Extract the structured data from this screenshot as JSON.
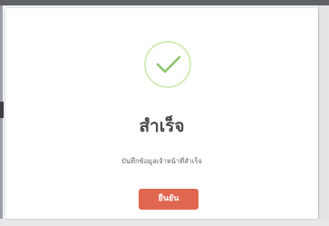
{
  "dialog": {
    "icon": "check-circle-icon",
    "title": "สำเร็จ",
    "message": "บันทึกข้อมูลเจ้าหน้าที่สำเร็จ",
    "confirm_label": "ยืนยัน"
  },
  "colors": {
    "accent": "#e0664f",
    "success": "#8cc56a",
    "title_text": "#4a4a4a",
    "overlay": "#f4f4f5"
  }
}
